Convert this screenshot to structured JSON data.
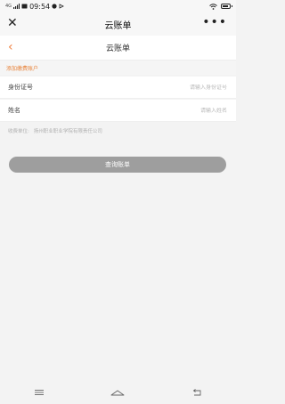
{
  "status_bar": {
    "signal": "4G",
    "time": "09:54"
  },
  "wechat": {
    "title": "云账单",
    "close_icon": "close-icon",
    "more_icon": "more-icon",
    "more_glyph": "•••"
  },
  "header": {
    "title": "云账单",
    "back_icon": "chevron-left-icon"
  },
  "form": {
    "section_label": "添加缴费账户",
    "id_label": "身份证号",
    "id_placeholder": "请输入身份证号",
    "name_label": "姓名",
    "name_placeholder": "请输入姓名",
    "payee_label": "收费单位:",
    "payee_value": "扬州职业职业学院有限责任公司"
  },
  "button": {
    "query_label": "查询账单"
  },
  "colors": {
    "accent": "#e8843c",
    "button_bg": "#9e9e9e"
  }
}
